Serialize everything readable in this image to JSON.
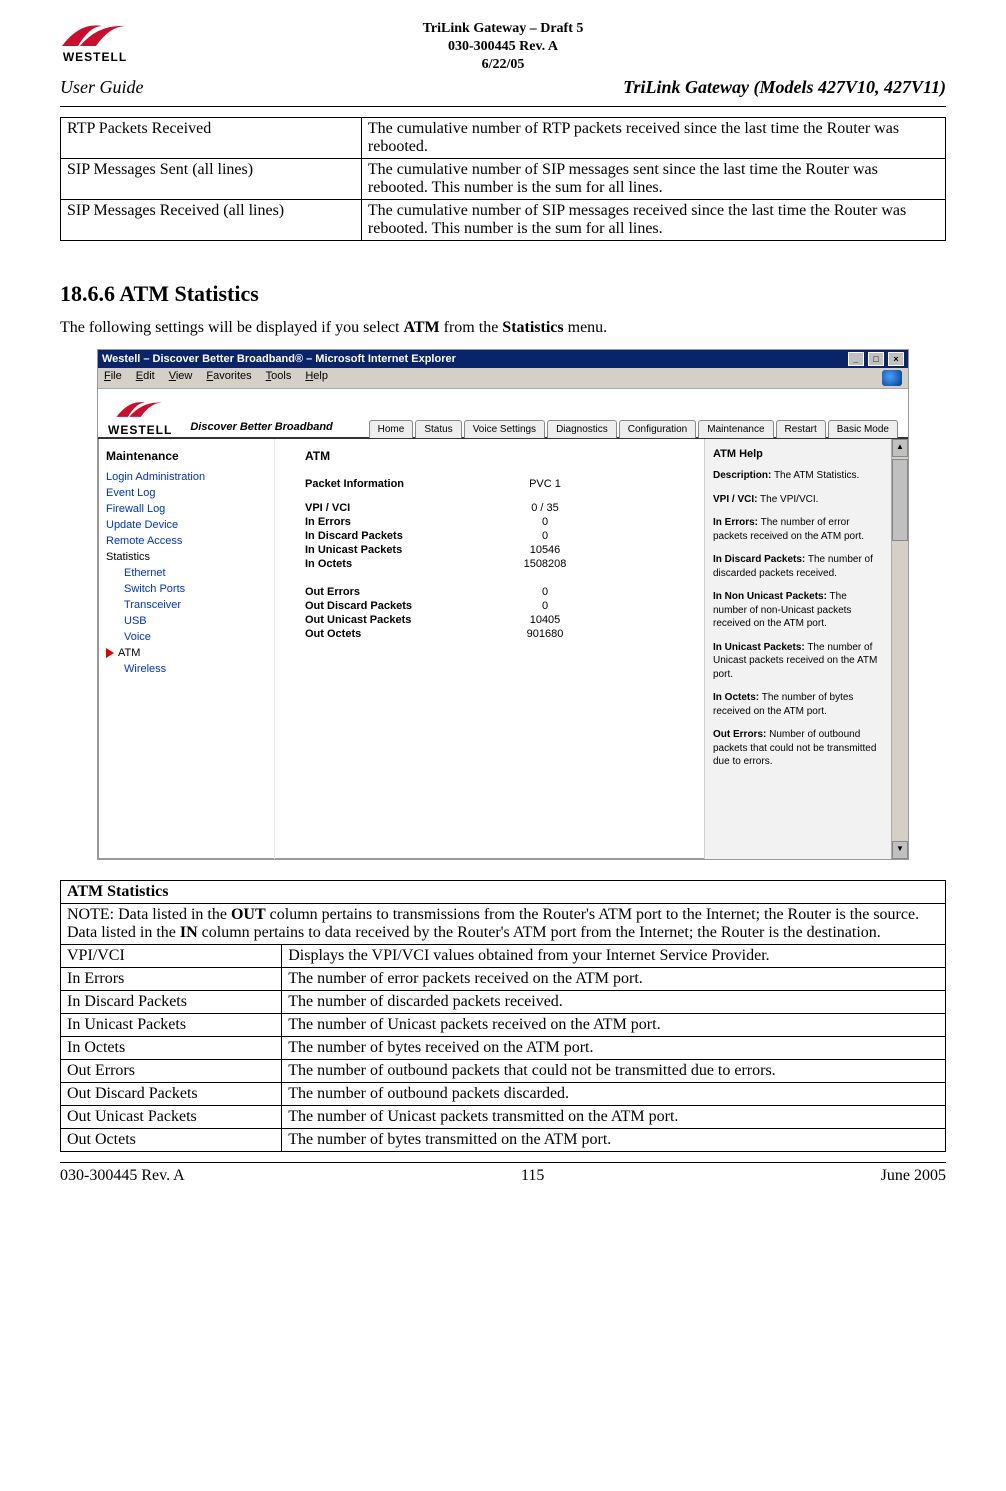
{
  "header": {
    "logo_text": "WESTELL",
    "title_line1": "TriLink Gateway – Draft 5",
    "title_line2": "030-300445 Rev. A",
    "title_line3": "6/22/05",
    "user_guide": "User Guide",
    "models": "TriLink Gateway (Models 427V10, 427V11)"
  },
  "top_table": {
    "rows": [
      {
        "label": "RTP Packets Received",
        "desc": "The cumulative number of RTP packets received since the last time the Router was rebooted."
      },
      {
        "label": "SIP Messages Sent (all lines)",
        "desc": "The cumulative number of SIP messages sent since the last time the Router was rebooted. This number is the sum for all lines."
      },
      {
        "label": "SIP Messages Received (all lines)",
        "desc": "The cumulative number of SIP messages received since the last time the Router was rebooted. This number is the sum for all lines."
      }
    ]
  },
  "section": {
    "heading": "18.6.6 ATM Statistics",
    "intro_pre": "The following settings will be displayed if you select ",
    "intro_b1": "ATM",
    "intro_mid": " from the ",
    "intro_b2": "Statistics",
    "intro_post": " menu."
  },
  "screenshot": {
    "titlebar": "Westell – Discover Better Broadband® – Microsoft Internet Explorer",
    "menus": [
      "File",
      "Edit",
      "View",
      "Favorites",
      "Tools",
      "Help"
    ],
    "brand_name": "WESTELL",
    "brand_tag": "Discover Better Broadband",
    "tabs": [
      "Home",
      "Status",
      "Voice Settings",
      "Diagnostics",
      "Configuration",
      "Maintenance",
      "Restart",
      "Basic Mode"
    ],
    "sidebar": {
      "title": "Maintenance",
      "items": [
        "Login Administration",
        "Event Log",
        "Firewall Log",
        "Update Device",
        "Remote Access",
        "Statistics"
      ],
      "sub_items": [
        "Ethernet",
        "Switch Ports",
        "Transceiver",
        "USB",
        "Voice",
        "ATM",
        "Wireless"
      ],
      "active": "ATM"
    },
    "main": {
      "title": "ATM",
      "subtitle": "Packet Information",
      "pvc": "PVC 1",
      "labels_in": [
        "VPI / VCI",
        "In Errors",
        "In Discard Packets",
        "In Unicast Packets",
        "In Octets"
      ],
      "values_in": [
        "0 / 35",
        "0",
        "0",
        "10546",
        "1508208"
      ],
      "labels_out": [
        "Out Errors",
        "Out Discard Packets",
        "Out Unicast Packets",
        "Out Octets"
      ],
      "values_out": [
        "0",
        "0",
        "10405",
        "901680"
      ]
    },
    "help": {
      "title": "ATM Help",
      "items": [
        {
          "b": "Description:",
          "t": " The ATM Statistics."
        },
        {
          "b": "VPI / VCI:",
          "t": " The VPI/VCI."
        },
        {
          "b": "In Errors:",
          "t": " The number of error packets received on the ATM port."
        },
        {
          "b": "In Discard Packets:",
          "t": " The number of discarded packets received."
        },
        {
          "b": "In Non Unicast Packets:",
          "t": " The number of non-Unicast packets received on the ATM port."
        },
        {
          "b": "In Unicast Packets:",
          "t": " The number of Unicast packets received on the ATM port."
        },
        {
          "b": "In Octets:",
          "t": " The number of bytes received on the ATM port."
        },
        {
          "b": "Out Errors:",
          "t": " Number of outbound packets that could not be transmitted due to errors."
        }
      ]
    }
  },
  "atm_table": {
    "heading": "ATM Statistics",
    "note_pre": "NOTE: Data listed in the ",
    "note_b1": "OUT",
    "note_mid1": " column pertains to transmissions from the Router's ATM port to the Internet; the Router is the source. Data listed in the ",
    "note_b2": "IN",
    "note_mid2": " column pertains to data received by the Router's ATM port from the Internet; the Router is the destination.",
    "rows": [
      {
        "label": "VPI/VCI",
        "desc": "Displays the VPI/VCI values obtained from your Internet Service Provider."
      },
      {
        "label": "In Errors",
        "desc": "The number of error packets received on the ATM port."
      },
      {
        "label": "In Discard Packets",
        "desc": "The number of discarded packets received."
      },
      {
        "label": "In Unicast Packets",
        "desc": "The number of Unicast packets received on the ATM port."
      },
      {
        "label": "In Octets",
        "desc": "The number of bytes received on the ATM port."
      },
      {
        "label": "Out Errors",
        "desc": "The number of outbound packets that could not be transmitted due to errors."
      },
      {
        "label": "Out Discard Packets",
        "desc": "The number of outbound packets discarded."
      },
      {
        "label": "Out Unicast Packets",
        "desc": "The number of Unicast packets transmitted on the ATM port."
      },
      {
        "label": "Out Octets",
        "desc": "The number of bytes transmitted on the ATM port."
      }
    ]
  },
  "footer": {
    "left": "030-300445 Rev. A",
    "center": "115",
    "right": "June 2005"
  }
}
